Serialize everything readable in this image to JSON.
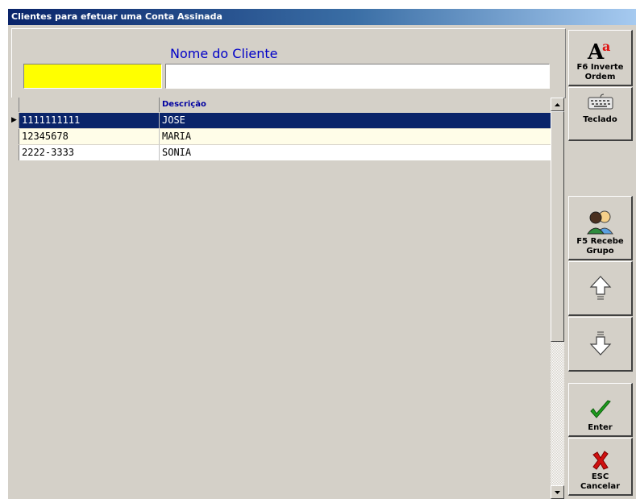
{
  "window": {
    "title": "Clientes para efetuar uma Conta Assinada"
  },
  "filter": {
    "label": "Nome do Cliente",
    "code_value": "",
    "name_value": ""
  },
  "grid": {
    "columns": [
      "",
      "Descrição"
    ],
    "rows": [
      {
        "code": "1111111111",
        "desc": "JOSE",
        "selected": true
      },
      {
        "code": "12345678",
        "desc": "MARIA",
        "selected": false
      },
      {
        "code": "2222-3333",
        "desc": "SONIA",
        "selected": false
      }
    ],
    "selected_indicator": "▶"
  },
  "toolbar": {
    "invert_order": {
      "line1": "F6 Inverte",
      "line2": "Ordem",
      "icon": "font-size-icon"
    },
    "keyboard": {
      "label": "Teclado",
      "icon": "keyboard-icon"
    },
    "receive_group": {
      "line1": "F5 Recebe",
      "line2": "Grupo",
      "icon": "people-icon"
    },
    "up": {
      "icon": "arrow-up-icon"
    },
    "down": {
      "icon": "arrow-down-icon"
    },
    "enter": {
      "label": "Enter",
      "icon": "checkmark-icon"
    },
    "cancel": {
      "line1": "ESC",
      "line2": "Cancelar",
      "icon": "x-icon"
    }
  },
  "colors": {
    "title_bar": "#0a246a",
    "selection": "#0a246a",
    "code_field": "#ffff00",
    "label_text": "#0000c8",
    "enter_green": "#1e9e1e",
    "cancel_red": "#d01010"
  }
}
